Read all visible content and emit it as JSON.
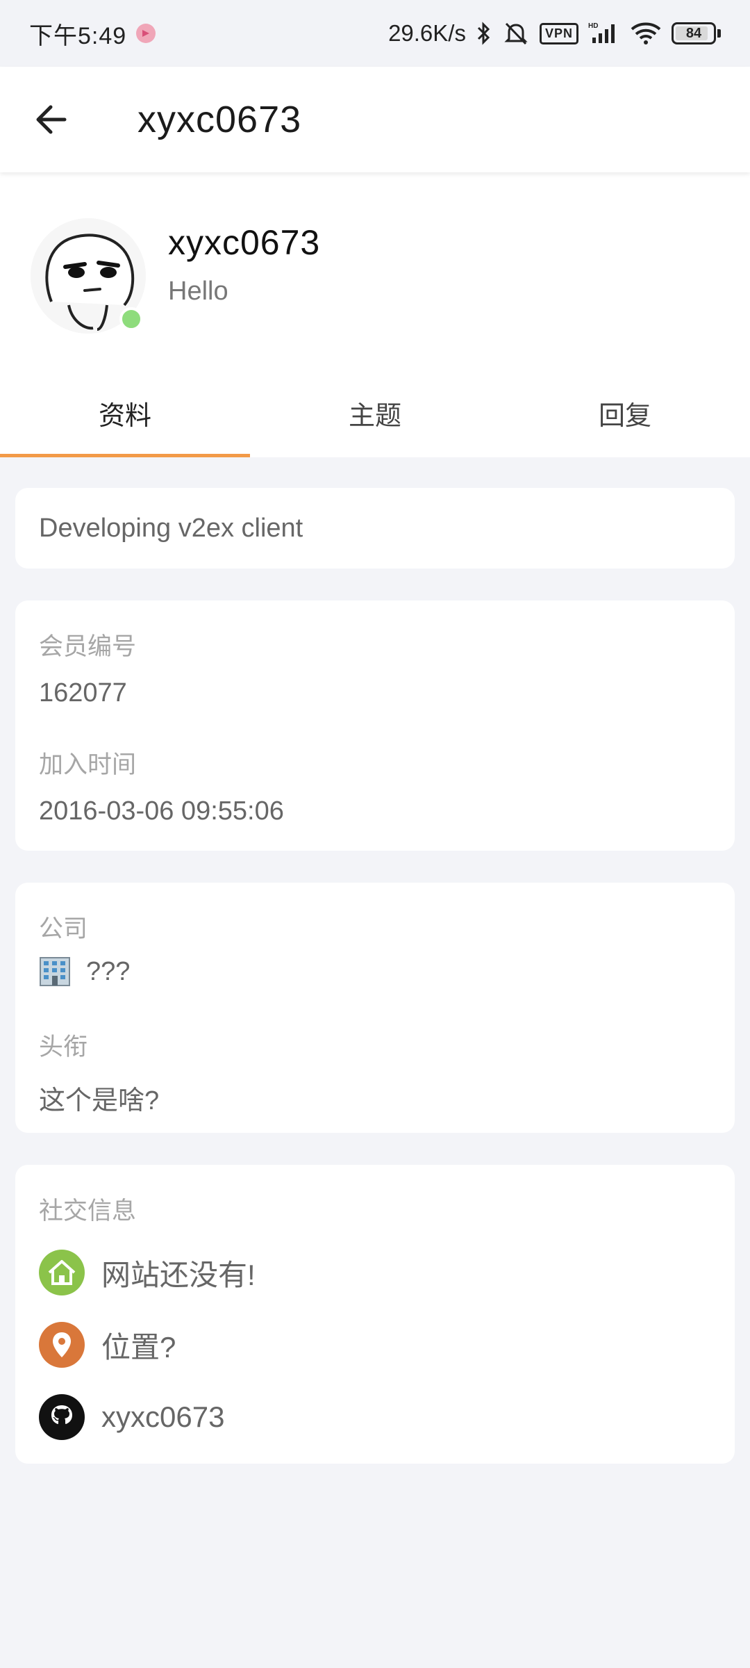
{
  "status_bar": {
    "time": "下午5:49",
    "net_speed": "29.6K/s",
    "vpn": "VPN",
    "battery": "84"
  },
  "app_bar": {
    "title": "xyxc0673"
  },
  "profile": {
    "username": "xyxc0673",
    "tagline": "Hello",
    "online": true
  },
  "tabs": [
    {
      "label": "资料",
      "active": true
    },
    {
      "label": "主题",
      "active": false
    },
    {
      "label": "回复",
      "active": false
    }
  ],
  "about": "Developing v2ex client",
  "member_info": {
    "number_label": "会员编号",
    "number": "162077",
    "joined_label": "加入时间",
    "joined": "2016-03-06 09:55:06"
  },
  "work_info": {
    "company_label": "公司",
    "company": "???",
    "title_label": "头衔",
    "title": "这个是啥?"
  },
  "social": {
    "label": "社交信息",
    "items": [
      {
        "icon": "home-icon",
        "text": "网站还没有!",
        "color": "#8bc34a"
      },
      {
        "icon": "location-pin-icon",
        "text": "位置?",
        "color": "#d9773a"
      },
      {
        "icon": "github-icon",
        "text": "xyxc0673",
        "color": "#111111"
      }
    ]
  },
  "colors": {
    "accent": "#f29a48",
    "online": "#8edc7c",
    "background": "#f3f4f8"
  }
}
